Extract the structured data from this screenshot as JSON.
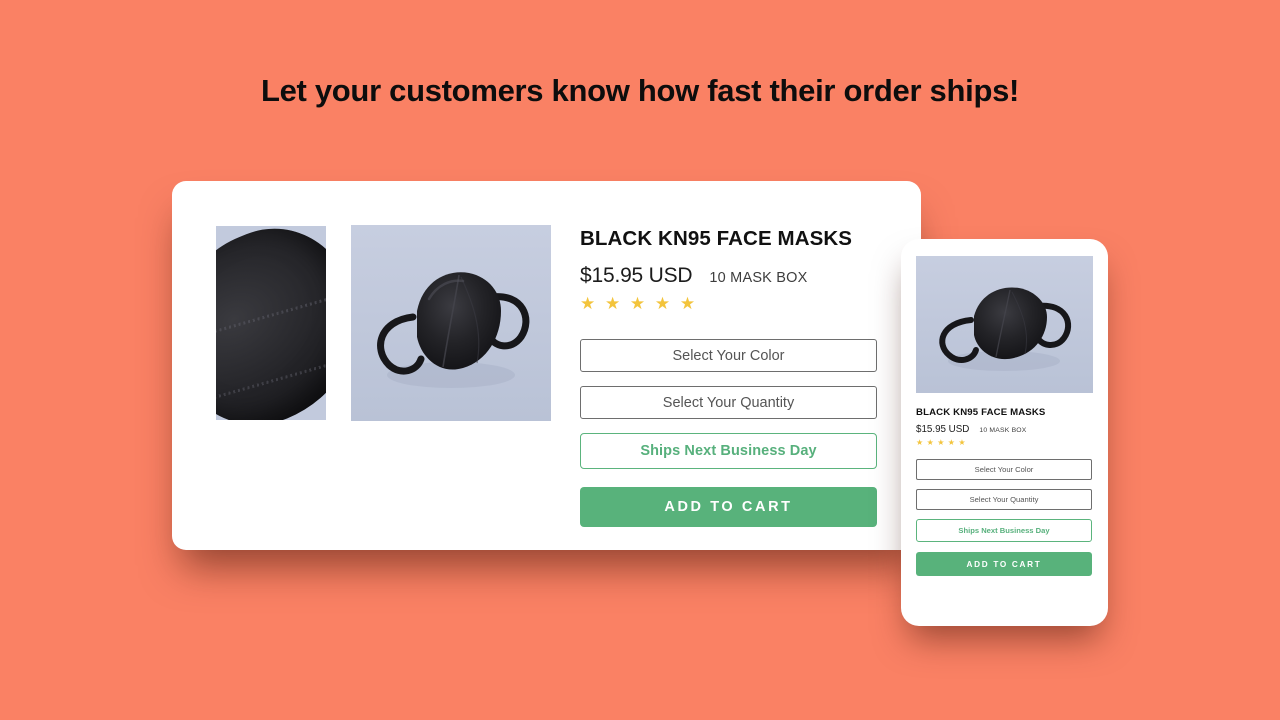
{
  "page": {
    "background_color": "#fa8164",
    "headline": "Let your customers know how fast their order ships!"
  },
  "product": {
    "title": "BLACK KN95 FACE MASKS",
    "price": "$15.95 USD",
    "variant_label": "10 MASK BOX",
    "rating_stars": "★ ★ ★ ★ ★",
    "rating_value": 5,
    "rating_max": 5,
    "star_color": "#f3c43c"
  },
  "desktop_card": {
    "gallery": [
      {
        "alt": "black-kn95-mask-closeup"
      },
      {
        "alt": "black-kn95-mask-angled"
      }
    ],
    "color_select_label": "Select Your Color",
    "quantity_select_label": "Select Your Quantity",
    "shipping_badge": "Ships Next Business Day",
    "add_to_cart_label": "ADD TO CART"
  },
  "mobile_card": {
    "gallery": [
      {
        "alt": "black-kn95-mask-angled"
      }
    ],
    "color_select_label": "Select Your Color",
    "quantity_select_label": "Select Your Quantity",
    "shipping_badge": "Ships Next Business Day",
    "add_to_cart_label": "ADD TO CART"
  },
  "theme": {
    "accent_green": "#58b27b",
    "badge_green": "#57b07c",
    "field_border": "#6e6e6e",
    "photo_background": "#c2cadd",
    "card_background": "#ffffff"
  }
}
